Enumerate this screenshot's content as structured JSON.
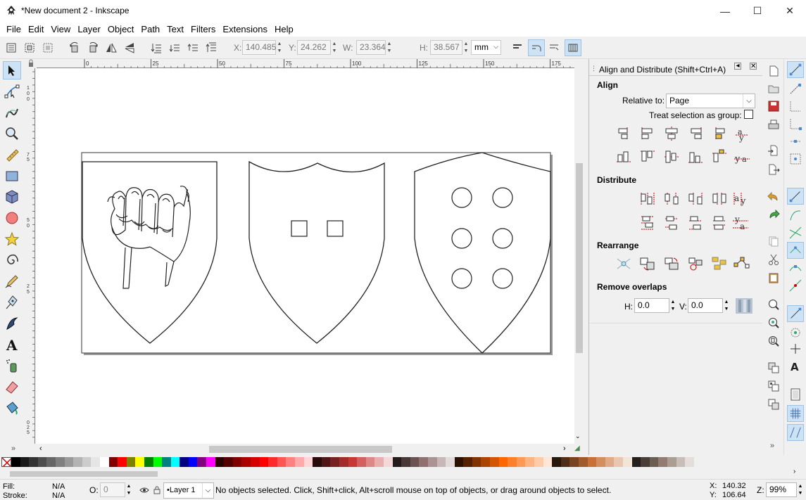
{
  "window": {
    "title": "*New document 2 - Inkscape",
    "minimize": "—",
    "maximize": "☐",
    "close": "✕"
  },
  "menu": [
    "File",
    "Edit",
    "View",
    "Layer",
    "Object",
    "Path",
    "Text",
    "Filters",
    "Extensions",
    "Help"
  ],
  "toolbar": {
    "x_label": "X:",
    "x_value": "140.485",
    "y_label": "Y:",
    "y_value": "24.262",
    "w_label": "W:",
    "w_value": "23.364",
    "h_label": "H:",
    "h_value": "38.567",
    "unit": "mm"
  },
  "ruler": {
    "top_ticks": [
      "0",
      "25",
      "50",
      "75",
      "100",
      "125",
      "150",
      "175"
    ],
    "left_ticks": [
      "1",
      "0",
      "0",
      "7",
      "5",
      "5",
      "0",
      "2",
      "5",
      "0",
      "2",
      "5"
    ]
  },
  "dialog": {
    "title": "Align and Distribute (Shift+Ctrl+A)",
    "align_title": "Align",
    "relative_label": "Relative to:",
    "relative_value": "Page",
    "group_label": "Treat selection as group:",
    "distribute_title": "Distribute",
    "rearrange_title": "Rearrange",
    "remove_overlaps_title": "Remove overlaps",
    "h_label": "H:",
    "h_value": "0.0",
    "v_label": "V:",
    "v_value": "0.0"
  },
  "status": {
    "fill_label": "Fill:",
    "fill_value": "N/A",
    "stroke_label": "Stroke:",
    "stroke_value": "N/A",
    "opacity_label": "O:",
    "opacity_value": "0",
    "layer": "•Layer 1",
    "message": "No objects selected. Click, Shift+click, Alt+scroll mouse on top of objects, or drag around objects to select.",
    "x_label": "X:",
    "x_coord": "140.32",
    "y_label": "Y:",
    "y_coord": "106.64",
    "zoom_label": "Z:",
    "zoom_value": "99%"
  },
  "colors": {
    "accent": "#cde3f5",
    "palette": [
      "#000000",
      "#1a1a1a",
      "#333333",
      "#4d4d4d",
      "#666666",
      "#808080",
      "#999999",
      "#b3b3b3",
      "#cccccc",
      "#e6e6e6",
      "#ffffff",
      "#800000",
      "#ff0000",
      "#808000",
      "#ffff00",
      "#008000",
      "#00ff00",
      "#008080",
      "#00ffff",
      "#000080",
      "#0000ff",
      "#800080",
      "#ff00ff",
      "#2b0000",
      "#550000",
      "#800000",
      "#aa0000",
      "#d40000",
      "#ff0000",
      "#ff2a2a",
      "#ff5555",
      "#ff8080",
      "#ffaaaa",
      "#ffd5d5",
      "#280b0b",
      "#501616",
      "#782121",
      "#a02c2c",
      "#c83737",
      "#d35f5f",
      "#de8787",
      "#e9afaf",
      "#f4d7d7",
      "#241c1c",
      "#483737",
      "#6c5353",
      "#916f6f",
      "#ac9393",
      "#c8b7b7",
      "#e3dbdb",
      "#2b1100",
      "#552200",
      "#803300",
      "#aa4400",
      "#d45500",
      "#ff6600",
      "#ff7f2a",
      "#ff9955",
      "#ffb380",
      "#ffccaa",
      "#ffe6d5",
      "#28170b",
      "#502d16",
      "#784421",
      "#a05a2c",
      "#c87137",
      "#d38d5f",
      "#deaa87",
      "#e9c6af",
      "#f4e3d7",
      "#241f1c",
      "#483e37",
      "#6c5d53",
      "#917c6f",
      "#ac9d93",
      "#c8beb7",
      "#e3dedb"
    ]
  }
}
